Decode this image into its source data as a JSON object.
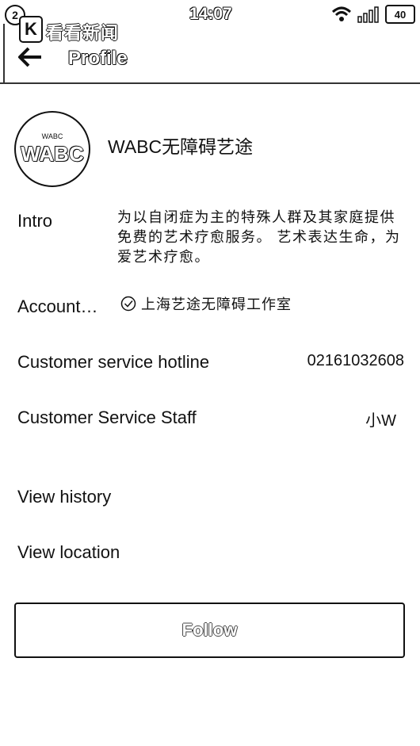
{
  "status_bar": {
    "notification_count": "2",
    "app_icon_glyph": "K",
    "app_name": "看看新闻",
    "time": "14:07",
    "battery": "40"
  },
  "header": {
    "title": "Profile"
  },
  "profile": {
    "avatar_top_text": "WABC",
    "avatar_text": "WABC",
    "name": "WABC无障碍艺途"
  },
  "rows": {
    "intro_label": "Intro",
    "intro_text": "为以自闭症为主的特殊人群及其家庭提供免费的艺术疗愈服务。 艺术表达生命，为爱艺术疗愈。",
    "account_label": "Account…",
    "account_value": "上海艺途无障碍工作室",
    "hotline_label": "Customer service hotline",
    "hotline_value": "02161032608",
    "staff_label": "Customer Service Staff",
    "staff_value": "小W",
    "history_label": "View history",
    "location_label": "View location"
  },
  "actions": {
    "follow_label": "Follow"
  },
  "icons": [
    "back-arrow-icon",
    "wifi-icon",
    "signal-icon",
    "battery-icon",
    "verified-check-icon"
  ]
}
